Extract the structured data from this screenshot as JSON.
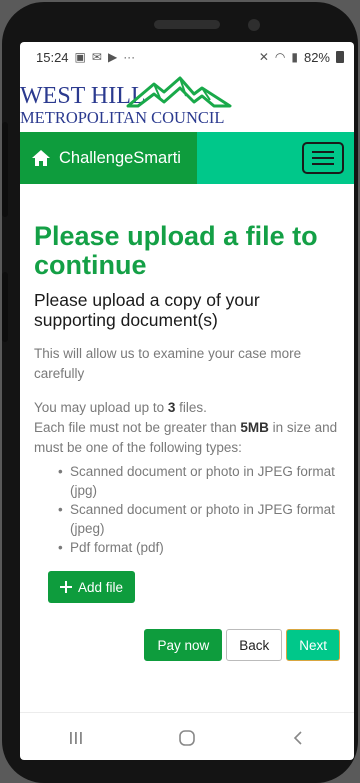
{
  "status_bar": {
    "time": "15:24",
    "more": "···",
    "battery": "82%"
  },
  "logo": {
    "line1": "WEST HILL",
    "line2": "METROPOLITAN COUNCIL"
  },
  "navbar": {
    "brand": "ChallengeSmarti"
  },
  "page": {
    "title": "Please upload a file to continue",
    "subtitle": "Please upload a copy of your supporting document(s)",
    "intro": "This will allow us to examine your case more carefully",
    "limit_prefix": "You may upload up to ",
    "limit_count": "3",
    "limit_suffix": " files.",
    "size_prefix": "Each file must not be greater than ",
    "size_value": "5MB",
    "size_suffix": " in size and must be one of the following types:",
    "file_types": [
      "Scanned document or photo in JPEG format (jpg)",
      "Scanned document or photo in JPEG format (jpeg)",
      "Pdf format (pdf)"
    ],
    "add_file_label": "Add file"
  },
  "actions": {
    "pay_now": "Pay now",
    "back": "Back",
    "next": "Next"
  },
  "colors": {
    "brand_green": "#0e9c3d",
    "accent_teal": "#00c88a",
    "logo_navy": "#2b3a8f"
  }
}
